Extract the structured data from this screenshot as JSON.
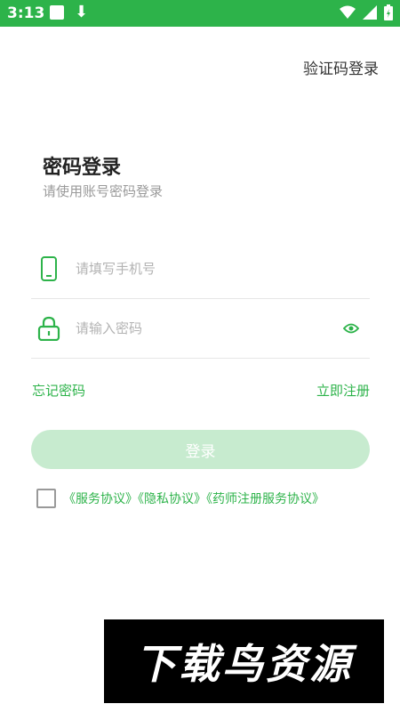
{
  "status_bar": {
    "time": "3:13",
    "color": "#2db34a"
  },
  "header": {
    "switch_mode_label": "验证码登录"
  },
  "form": {
    "title": "密码登录",
    "subtitle": "请使用账号密码登录",
    "phone_placeholder": "请填写手机号",
    "password_placeholder": "请输入密码",
    "forgot_label": "忘记密码",
    "register_label": "立即注册",
    "login_button_label": "登录"
  },
  "agreements": {
    "checked": false,
    "items": [
      "《服务协议》",
      "《隐私协议》",
      "《药师注册服务协议》"
    ]
  },
  "watermark": {
    "text": "下载鸟资源"
  },
  "theme": {
    "accent": "#2db34a",
    "button_disabled": "#c7ebcf"
  },
  "icons": [
    "phone-icon",
    "lock-icon",
    "eye-icon",
    "download-icon",
    "wifi-icon",
    "signal-icon",
    "battery-icon"
  ]
}
